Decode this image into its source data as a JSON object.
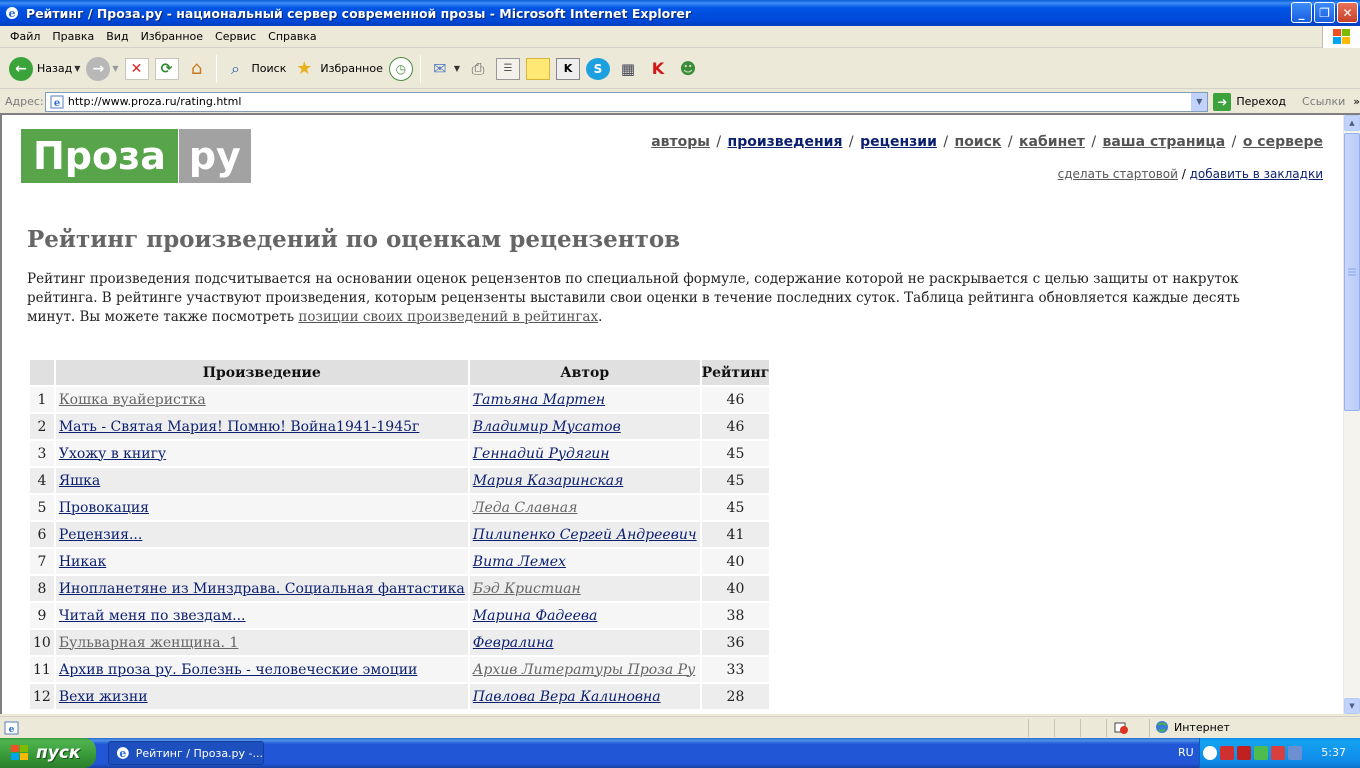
{
  "window": {
    "title": "Рейтинг / Проза.ру - национальный сервер современной прозы - Microsoft Internet Explorer"
  },
  "menu": [
    "Файл",
    "Правка",
    "Вид",
    "Избранное",
    "Сервис",
    "Справка"
  ],
  "toolbar": {
    "back_label": "Назад",
    "search_label": "Поиск",
    "favorites_label": "Избранное"
  },
  "address": {
    "label": "Адрес:",
    "url": "http://www.proza.ru/rating.html",
    "go_label": "Переход",
    "links_label": "Ссылки"
  },
  "site": {
    "logo_left": "Проза",
    "logo_right": "ру",
    "nav": [
      "авторы",
      "произведения",
      "рецензии",
      "поиск",
      "кабинет",
      "ваша страница",
      "о сервере"
    ],
    "subnav": [
      "сделать стартовой",
      "добавить в закладки"
    ]
  },
  "page": {
    "heading": "Рейтинг произведений по оценкам рецензентов",
    "desc_text": "Рейтинг произведения подсчитывается на основании оценок рецензентов по специальной формуле, содержание которой не раскрывается с целью защиты от накруток рейтинга. В рейтинге участвуют произведения, которым рецензенты выставили свои оценки в течение последних суток. Таблица рейтинга обновляется каждые десять минут. Вы можете также посмотреть ",
    "desc_link": "позиции своих произведений в рейтингах",
    "desc_end": "."
  },
  "table": {
    "headers": [
      "",
      "Произведение",
      "Автор",
      "Рейтинг"
    ],
    "rows": [
      {
        "n": "1",
        "work": "Кошка вуайеристка",
        "work_visited": true,
        "author": "Татьяна Мартен",
        "author_visited": false,
        "rating": "46"
      },
      {
        "n": "2",
        "work": "Мать - Святая Мария! Помню! Война1941-1945г",
        "work_visited": false,
        "author": "Владимир Мусатов",
        "author_visited": false,
        "rating": "46"
      },
      {
        "n": "3",
        "work": "Ухожу в книгу",
        "work_visited": false,
        "author": "Геннадий Рудягин",
        "author_visited": false,
        "rating": "45"
      },
      {
        "n": "4",
        "work": "Яшка",
        "work_visited": false,
        "author": "Мария Казаринская",
        "author_visited": false,
        "rating": "45"
      },
      {
        "n": "5",
        "work": "Провокация",
        "work_visited": false,
        "author": "Леда Славная",
        "author_visited": true,
        "rating": "45"
      },
      {
        "n": "6",
        "work": "Рецензия...",
        "work_visited": false,
        "author": "Пилипенко Сергей Андреевич",
        "author_visited": false,
        "rating": "41"
      },
      {
        "n": "7",
        "work": "Никак",
        "work_visited": false,
        "author": "Вита Лемех",
        "author_visited": false,
        "rating": "40"
      },
      {
        "n": "8",
        "work": "Инопланетяне из Минздрава. Социальная фантастика",
        "work_visited": false,
        "author": "Бэд Кристиан",
        "author_visited": true,
        "rating": "40"
      },
      {
        "n": "9",
        "work": "Читай меня по звездам...",
        "work_visited": false,
        "author": "Марина Фадеева",
        "author_visited": false,
        "rating": "38"
      },
      {
        "n": "10",
        "work": "Бульварная женщина. 1",
        "work_visited": true,
        "author": "Февралина",
        "author_visited": false,
        "rating": "36"
      },
      {
        "n": "11",
        "work": "Архив проза ру. Болезнь - человеческие эмоции",
        "work_visited": false,
        "author": "Архив Литературы Проза Ру",
        "author_visited": true,
        "rating": "33"
      },
      {
        "n": "12",
        "work": "Вехи жизни",
        "work_visited": false,
        "author": "Павлова Вера Калиновна",
        "author_visited": false,
        "rating": "28"
      }
    ]
  },
  "status": {
    "zone": "Интернет"
  },
  "taskbar": {
    "start_label": "пуск",
    "task_label": "Рейтинг / Проза.ру -...",
    "lang": "RU",
    "clock": "5:37"
  }
}
